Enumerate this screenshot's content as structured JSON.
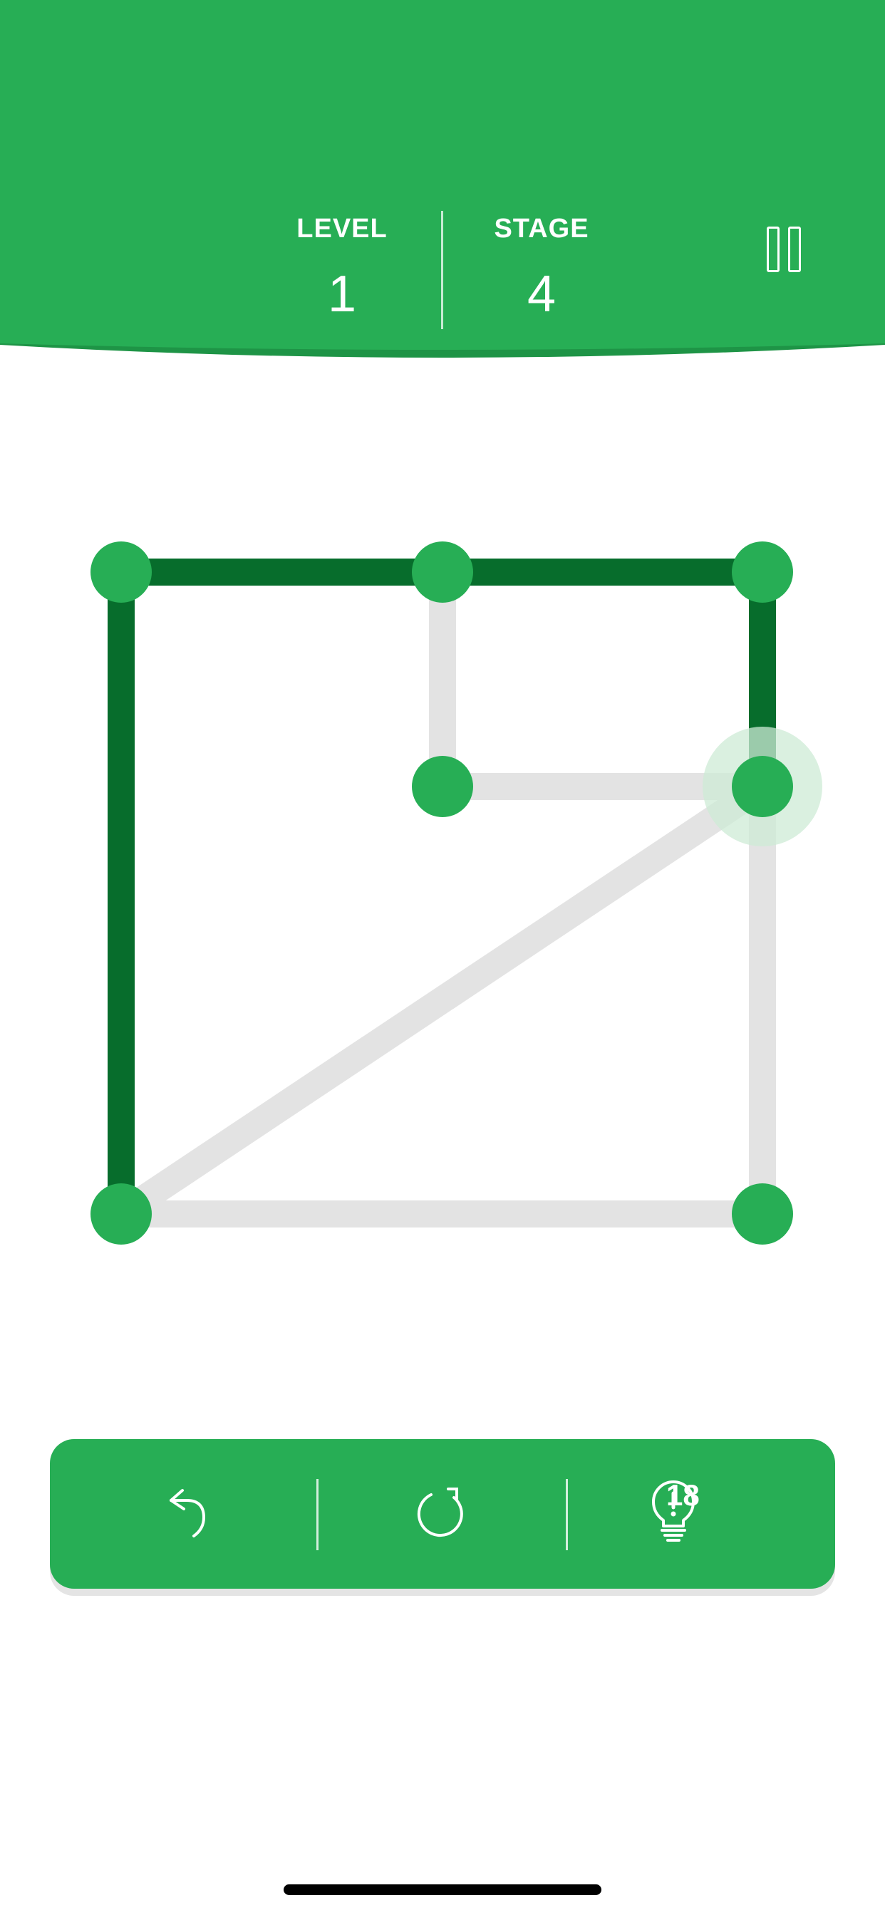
{
  "colors": {
    "brand_green": "#27ae55",
    "header_shadow": "#1e9446",
    "path_done": "#076d2c",
    "path_pending": "#e3e3e3",
    "node": "#27ae55",
    "active_halo": "#cdebd6"
  },
  "header": {
    "level_label": "LEVEL",
    "level_value": "1",
    "stage_label": "STAGE",
    "stage_value": "4",
    "pause_icon": "pause-icon"
  },
  "puzzle": {
    "nodes": [
      {
        "id": "A",
        "col": 0,
        "row": 0
      },
      {
        "id": "B",
        "col": 1,
        "row": 0
      },
      {
        "id": "C",
        "col": 2,
        "row": 0
      },
      {
        "id": "D",
        "col": 1,
        "row": 1
      },
      {
        "id": "E",
        "col": 2,
        "row": 1
      },
      {
        "id": "F",
        "col": 0,
        "row": 3
      },
      {
        "id": "G",
        "col": 2,
        "row": 3
      }
    ],
    "edges": [
      {
        "from": "A",
        "to": "B",
        "traced": true
      },
      {
        "from": "B",
        "to": "C",
        "traced": true
      },
      {
        "from": "C",
        "to": "E",
        "traced": true
      },
      {
        "from": "A",
        "to": "F",
        "traced": true
      },
      {
        "from": "B",
        "to": "D",
        "traced": false
      },
      {
        "from": "D",
        "to": "E",
        "traced": false
      },
      {
        "from": "E",
        "to": "F",
        "traced": false
      },
      {
        "from": "E",
        "to": "G",
        "traced": false
      },
      {
        "from": "F",
        "to": "G",
        "traced": false
      }
    ],
    "active_node": "E"
  },
  "controls": {
    "undo_icon": "undo-icon",
    "restart_icon": "restart-icon",
    "hint_icon": "lightbulb-icon",
    "hint_count": "18"
  }
}
